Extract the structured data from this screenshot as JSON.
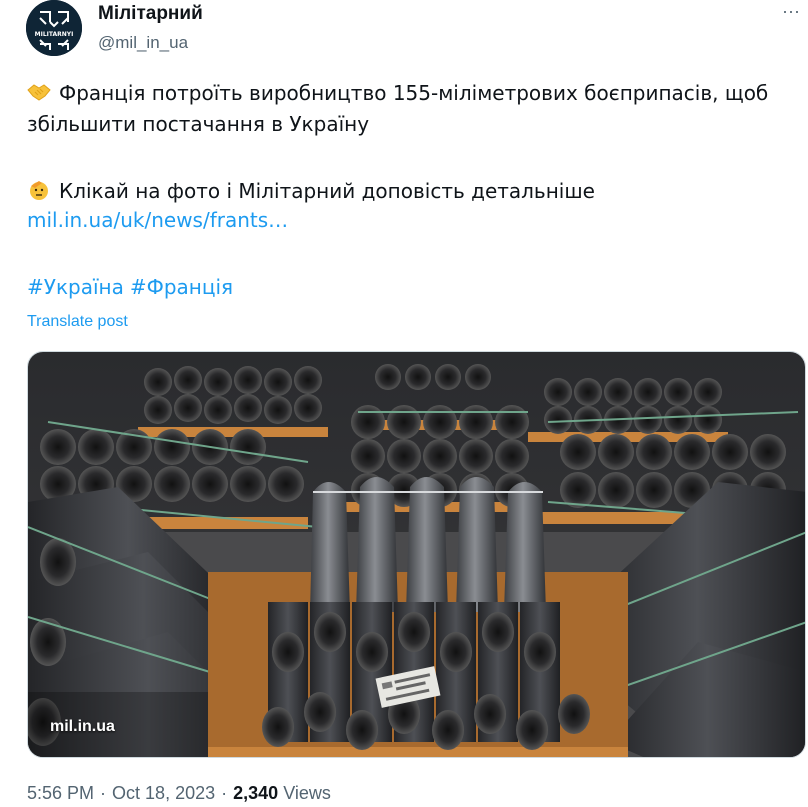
{
  "author": {
    "name": "Мілітарний",
    "handle": "@mil_in_ua",
    "avatar_text": "MILITARNYI"
  },
  "post": {
    "line1_emoji": "handshake-icon",
    "line1_text": "Франція потроїть виробництво 155-міліметрових боєприпасів, щоб збільшити постачання в Україну",
    "line2_emoji": "saluting-face-icon",
    "line2_text": "Клікай на фото і Мілітарний доповість детальніше",
    "link": "mil.in.ua/uk/news/frants…",
    "hashtags": [
      "#Україна",
      "#Франція"
    ],
    "translate": "Translate post"
  },
  "media": {
    "caption": "mil.in.ua",
    "alt": "artillery-shells-warehouse"
  },
  "meta": {
    "time": "5:56 PM",
    "date": "Oct 18, 2023",
    "views_count": "2,340",
    "views_label": "Views"
  },
  "colors": {
    "link": "#1d9bf0",
    "secondary": "#536471",
    "avatar_bg": "#0f2536"
  }
}
